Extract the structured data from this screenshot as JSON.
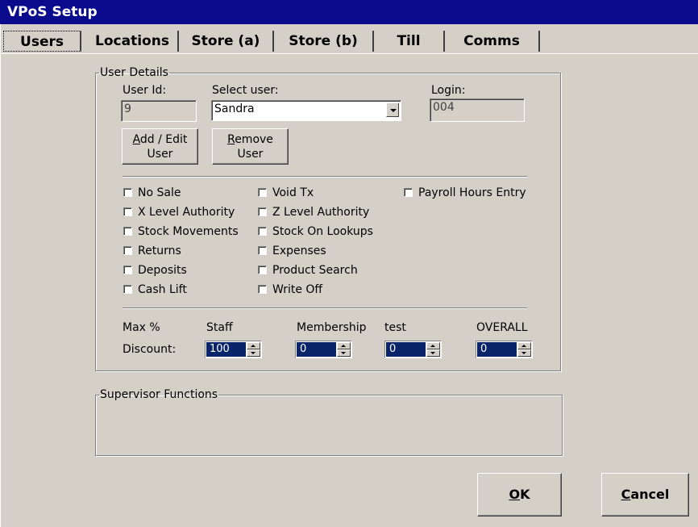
{
  "window": {
    "title": "VPoS Setup"
  },
  "tabs": [
    {
      "label": "Users"
    },
    {
      "label": "Locations"
    },
    {
      "label": "Store (a)"
    },
    {
      "label": "Store (b)"
    },
    {
      "label": "Till"
    },
    {
      "label": "Comms"
    }
  ],
  "user_details": {
    "legend": "User Details",
    "user_id_label": "User Id:",
    "user_id_value": "9",
    "select_user_label": "Select user:",
    "select_user_value": "Sandra",
    "login_label": "Login:",
    "login_value": "004",
    "add_edit_line1_rest": "dd / Edit",
    "add_edit_mnemonic": "A",
    "add_edit_line2": "User",
    "remove_mnemonic": "R",
    "remove_line1_rest": "emove",
    "remove_line2": "User"
  },
  "permissions": [
    {
      "label": "No Sale",
      "checked": false
    },
    {
      "label": "X Level Authority",
      "checked": false
    },
    {
      "label": "Stock Movements",
      "checked": false
    },
    {
      "label": "Returns",
      "checked": false
    },
    {
      "label": "Deposits",
      "checked": false
    },
    {
      "label": "Cash Lift",
      "checked": false
    },
    {
      "label": "Void Tx",
      "checked": false
    },
    {
      "label": "Z Level Authority",
      "checked": false
    },
    {
      "label": "Stock On Lookups",
      "checked": false
    },
    {
      "label": "Expenses",
      "checked": false
    },
    {
      "label": "Product Search",
      "checked": false
    },
    {
      "label": "Write Off",
      "checked": false
    },
    {
      "label": "Payroll Hours Entry",
      "checked": false
    }
  ],
  "discount": {
    "max_label": "Max %",
    "discount_label": "Discount:",
    "columns": [
      {
        "label": "Staff",
        "value": "100"
      },
      {
        "label": "Membership",
        "value": "0"
      },
      {
        "label": "test",
        "value": "0"
      },
      {
        "label": "OVERALL",
        "value": "0"
      }
    ]
  },
  "supervisor": {
    "legend": "Supervisor Functions"
  },
  "buttons": {
    "ok_mnemonic": "O",
    "ok_rest": "K",
    "cancel_mnemonic": "C",
    "cancel_rest": "ancel"
  }
}
